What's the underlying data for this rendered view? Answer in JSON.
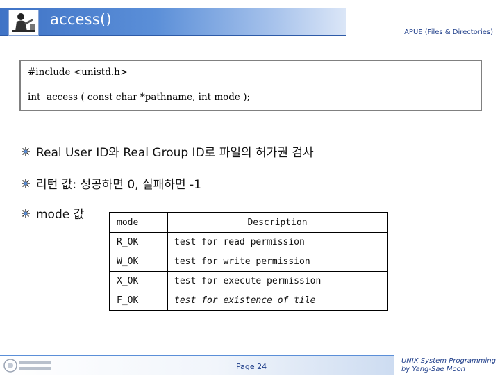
{
  "slide": {
    "title": "access()",
    "header_note": "APUE (Files & Directories)"
  },
  "code": {
    "line1": "#include <unistd.h>",
    "line2": "int  access ( const char *pathname, int mode );"
  },
  "bullets": [
    {
      "text": "Real User ID와 Real Group ID로 파일의 허가권 검사"
    },
    {
      "text": "리턴 값: 성공하면 0, 실패하면 -1"
    },
    {
      "text": "mode 값"
    }
  ],
  "mode_table": {
    "headers": [
      "mode",
      "Description"
    ],
    "rows": [
      {
        "mode": "R_OK",
        "desc": "test for read permission"
      },
      {
        "mode": "W_OK",
        "desc": "test for write permission"
      },
      {
        "mode": "X_OK",
        "desc": "test for execute permission"
      },
      {
        "mode": "F_OK",
        "desc": "test for existence of tile"
      }
    ]
  },
  "footer": {
    "page": "Page 24",
    "credit_line1": "UNIX System Programming",
    "credit_line2": "by Yang-Sae Moon"
  },
  "colors": {
    "title_band": "#3f73c6",
    "accent_text": "#1f3e8a"
  },
  "icons": {
    "logo": "teacher-at-desk-icon",
    "bullet": "starburst-bullet-icon",
    "footer_logo": "university-seal-icon"
  }
}
